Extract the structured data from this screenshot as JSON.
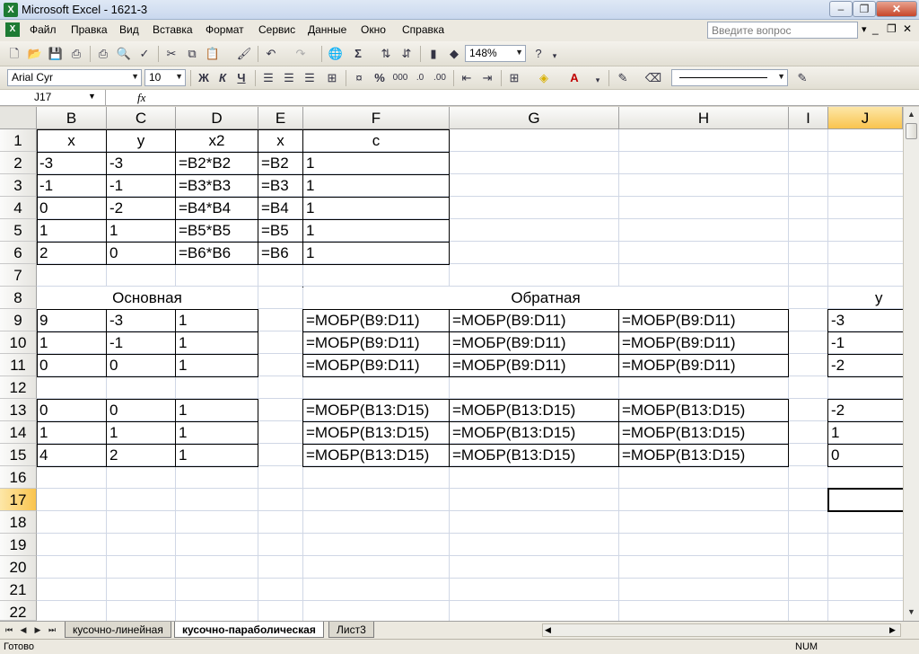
{
  "window": {
    "title": "Microsoft Excel - 1621-3"
  },
  "menu": {
    "items": [
      "Файл",
      "Правка",
      "Вид",
      "Вставка",
      "Формат",
      "Сервис",
      "Данные",
      "Окно",
      "Справка"
    ],
    "help_placeholder": "Введите вопрос"
  },
  "toolbar": {
    "zoom": "148%",
    "font_name": "Arial Cyr",
    "font_size": "10",
    "bold": "Ж",
    "italic": "К",
    "underline": "Ч",
    "sigma": "Σ",
    "percent": "%",
    "thousands": "000"
  },
  "formula_bar": {
    "name_box": "J17",
    "fx": "fx",
    "content": ""
  },
  "columns": [
    "B",
    "C",
    "D",
    "E",
    "F",
    "G",
    "H",
    "I",
    "J"
  ],
  "rows": [
    "1",
    "2",
    "3",
    "4",
    "5",
    "6",
    "7",
    "8",
    "9",
    "10",
    "11",
    "12",
    "13",
    "14",
    "15",
    "16",
    "17",
    "18",
    "19",
    "20",
    "21",
    "22"
  ],
  "selected": {
    "column": "J",
    "row": "17"
  },
  "cells": {
    "header": [
      "x",
      "y",
      "x2",
      "x",
      "c"
    ],
    "data_rows": [
      [
        "-3",
        "-3",
        "=B2*B2",
        "=B2",
        "1"
      ],
      [
        "-1",
        "-1",
        "=B3*B3",
        "=B3",
        "1"
      ],
      [
        "0",
        "-2",
        "=B4*B4",
        "=B4",
        "1"
      ],
      [
        "1",
        "1",
        "=B5*B5",
        "=B5",
        "1"
      ],
      [
        "2",
        "0",
        "=B6*B6",
        "=B6",
        "1"
      ]
    ],
    "label_main": "Основная",
    "label_inverse": "Обратная",
    "label_y": "y",
    "main_block1": [
      [
        "9",
        "-3",
        "1"
      ],
      [
        "1",
        "-1",
        "1"
      ],
      [
        "0",
        "0",
        "1"
      ]
    ],
    "inverse_block1": [
      [
        "=МОБР(B9:D11)",
        "=МОБР(B9:D11)",
        "=МОБР(B9:D11)"
      ],
      [
        "=МОБР(B9:D11)",
        "=МОБР(B9:D11)",
        "=МОБР(B9:D11)"
      ],
      [
        "=МОБР(B9:D11)",
        "=МОБР(B9:D11)",
        "=МОБР(B9:D11)"
      ]
    ],
    "y_block1": [
      "-3",
      "-1",
      "-2"
    ],
    "main_block2": [
      [
        "0",
        "0",
        "1"
      ],
      [
        "1",
        "1",
        "1"
      ],
      [
        "4",
        "2",
        "1"
      ]
    ],
    "inverse_block2": [
      [
        "=МОБР(B13:D15)",
        "=МОБР(B13:D15)",
        "=МОБР(B13:D15)"
      ],
      [
        "=МОБР(B13:D15)",
        "=МОБР(B13:D15)",
        "=МОБР(B13:D15)"
      ],
      [
        "=МОБР(B13:D15)",
        "=МОБР(B13:D15)",
        "=МОБР(B13:D15)"
      ]
    ],
    "y_block2": [
      "-2",
      "1",
      "0"
    ]
  },
  "sheet_tabs": [
    "кусочно-линейная",
    "кусочно-параболическая",
    "Лист3"
  ],
  "active_tab": "кусочно-параболическая",
  "status": {
    "left": "Готово",
    "num": "NUM"
  }
}
